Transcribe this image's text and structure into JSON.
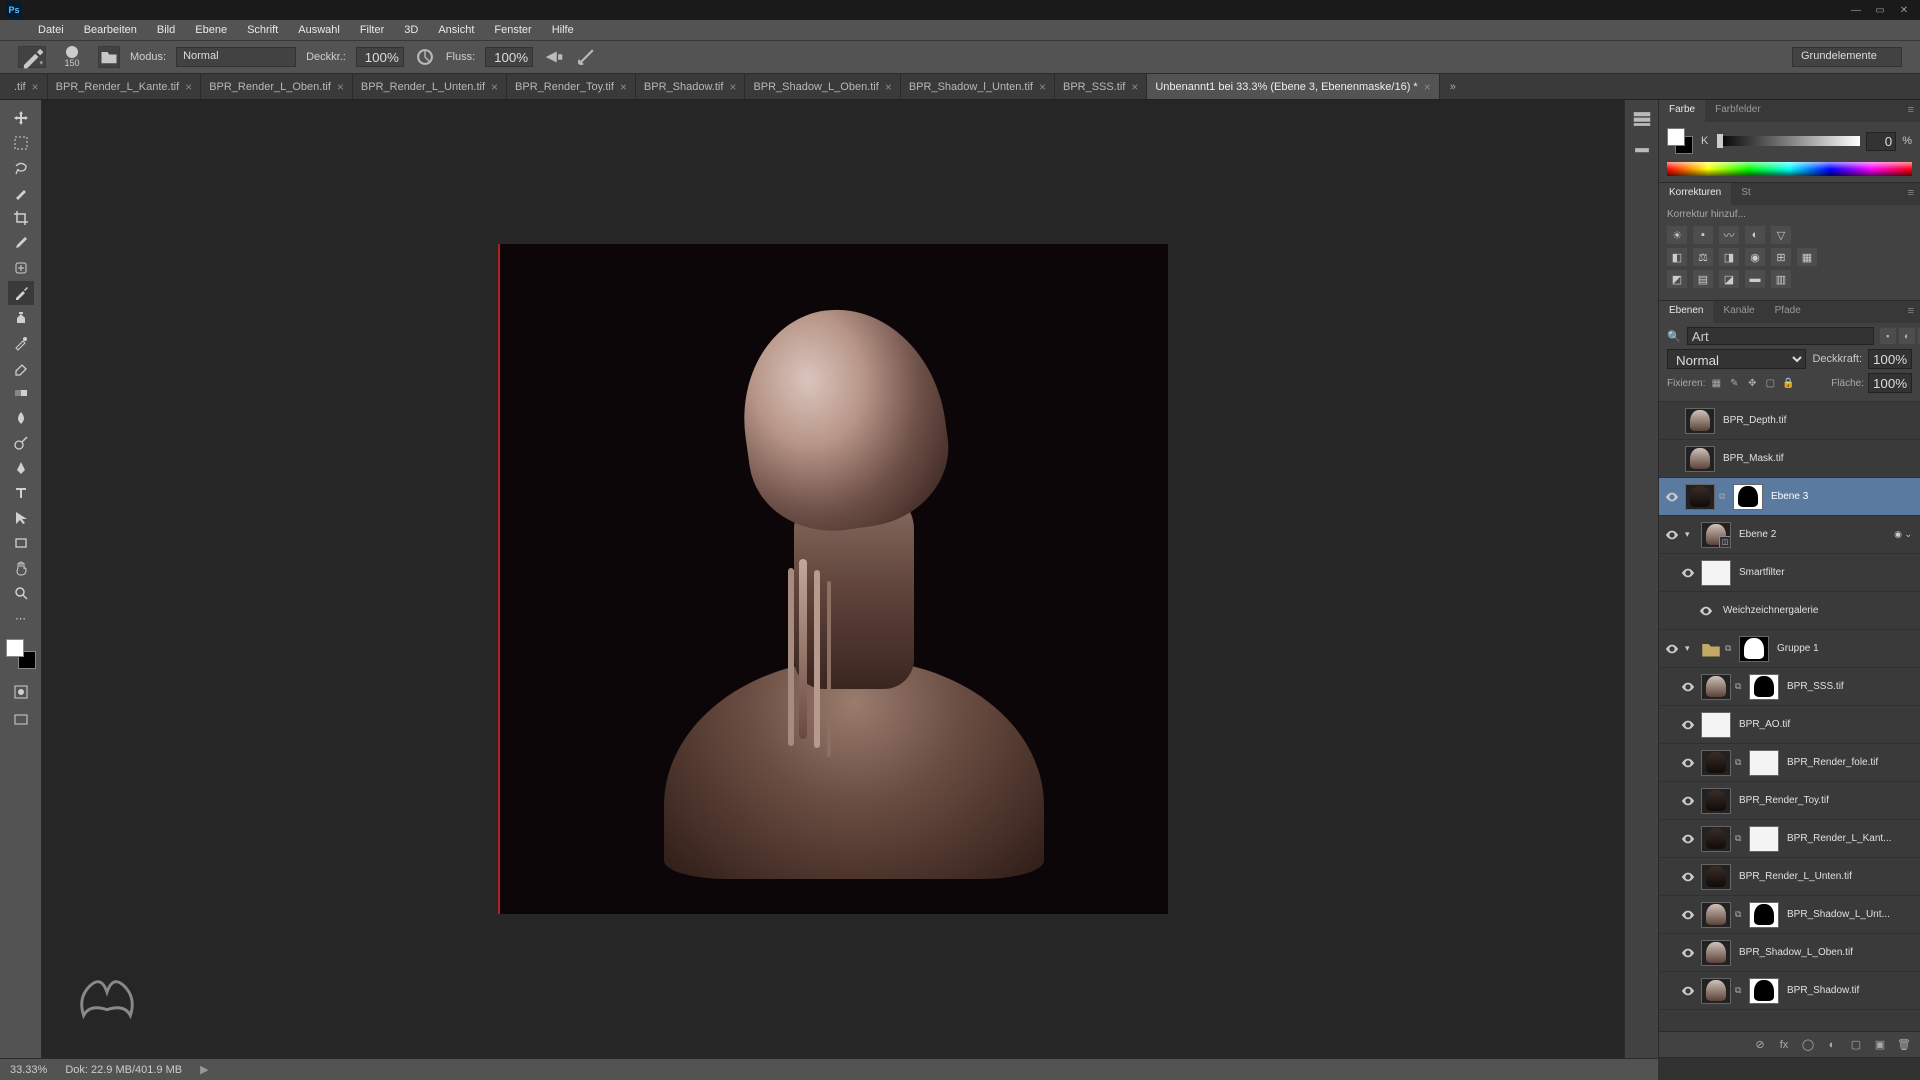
{
  "app": {
    "logo": "Ps"
  },
  "window_controls": {
    "min": "—",
    "max": "▭",
    "close": "✕"
  },
  "menu": [
    "Datei",
    "Bearbeiten",
    "Bild",
    "Ebene",
    "Schrift",
    "Auswahl",
    "Filter",
    "3D",
    "Ansicht",
    "Fenster",
    "Hilfe"
  ],
  "options": {
    "brush_size": "150",
    "modus_label": "Modus:",
    "modus_value": "Normal",
    "deckkr_label": "Deckkr.:",
    "deckkr_value": "100%",
    "fluss_label": "Fluss:",
    "fluss_value": "100%",
    "workspace": "Grundelemente"
  },
  "tabs": [
    {
      "label": ".tif",
      "active": false
    },
    {
      "label": "BPR_Render_L_Kante.tif",
      "active": false
    },
    {
      "label": "BPR_Render_L_Oben.tif",
      "active": false
    },
    {
      "label": "BPR_Render_L_Unten.tif",
      "active": false
    },
    {
      "label": "BPR_Render_Toy.tif",
      "active": false
    },
    {
      "label": "BPR_Shadow.tif",
      "active": false
    },
    {
      "label": "BPR_Shadow_L_Oben.tif",
      "active": false
    },
    {
      "label": "BPR_Shadow_l_Unten.tif",
      "active": false
    },
    {
      "label": "BPR_SSS.tif",
      "active": false
    },
    {
      "label": "Unbenannt1 bei 33.3% (Ebene 3, Ebenenmaske/16) *",
      "active": true
    }
  ],
  "tabs_overflow": "»",
  "panels": {
    "color": {
      "tab1": "Farbe",
      "tab2": "Farbfelder",
      "slider_label": "K",
      "slider_value": "0",
      "slider_unit": "%"
    },
    "adjustments": {
      "tab1": "Korrekturen",
      "tab2": "St",
      "hint": "Korrektur hinzuf..."
    },
    "layers": {
      "tab1": "Ebenen",
      "tab2": "Kanäle",
      "tab3": "Pfade",
      "filter_placeholder": "Art",
      "blend_mode": "Normal",
      "deckkraft_label": "Deckkraft:",
      "deckkraft_value": "100%",
      "fixieren_label": "Fixieren:",
      "flaeche_label": "Fläche:",
      "flaeche_value": "100%"
    }
  },
  "layers": [
    {
      "visible": false,
      "name": "BPR_Depth.tif",
      "thumb": "light",
      "indent": 0
    },
    {
      "visible": false,
      "name": "BPR_Mask.tif",
      "thumb": "light",
      "indent": 0
    },
    {
      "visible": true,
      "name": "Ebene 3",
      "thumb": "dark",
      "mask": "black-sil",
      "linked": true,
      "selected": true,
      "indent": 0
    },
    {
      "visible": true,
      "name": "Ebene 2",
      "thumb": "light",
      "smart": true,
      "expand": true,
      "fx": true,
      "indent": 0
    },
    {
      "visible": true,
      "name": "Smartfilter",
      "thumb": "white",
      "indent": 1
    },
    {
      "visible": true,
      "name": "Weichzeichnergalerie",
      "thumb": "none",
      "indent": 2
    },
    {
      "visible": true,
      "name": "Gruppe 1",
      "folder": true,
      "mask": "white-sil",
      "linked": true,
      "expand": true,
      "indent": 0
    },
    {
      "visible": true,
      "name": "BPR_SSS.tif",
      "thumb": "light",
      "mask": "black-sil",
      "linked": true,
      "indent": 1
    },
    {
      "visible": true,
      "name": "BPR_AO.tif",
      "thumb": "white",
      "indent": 1
    },
    {
      "visible": true,
      "name": "BPR_Render_fole.tif",
      "thumb": "dark",
      "mask": "white",
      "linked": true,
      "indent": 1
    },
    {
      "visible": true,
      "name": "BPR_Render_Toy.tif",
      "thumb": "dark",
      "indent": 1
    },
    {
      "visible": true,
      "name": "BPR_Render_L_Kant...",
      "thumb": "dark",
      "mask": "white",
      "linked": true,
      "indent": 1
    },
    {
      "visible": true,
      "name": "BPR_Render_L_Unten.tif",
      "thumb": "dark",
      "indent": 1
    },
    {
      "visible": true,
      "name": "BPR_Shadow_L_Unt...",
      "thumb": "light",
      "mask": "black-sil",
      "linked": true,
      "indent": 1
    },
    {
      "visible": true,
      "name": "BPR_Shadow_L_Oben.tif",
      "thumb": "light",
      "indent": 1
    },
    {
      "visible": true,
      "name": "BPR_Shadow.tif",
      "thumb": "light",
      "mask": "black-sil",
      "linked": true,
      "indent": 1
    }
  ],
  "status": {
    "zoom": "33.33%",
    "doc": "Dok: 22.9 MB/401.9 MB",
    "arrow": "▶"
  }
}
